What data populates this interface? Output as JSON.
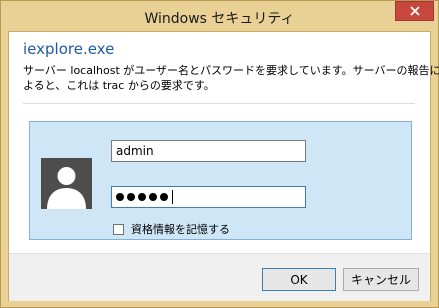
{
  "window": {
    "title": "Windows セキュリティ",
    "close_icon": "close-icon"
  },
  "dialog": {
    "app_name": "iexplore.exe",
    "message_line1": "サーバー localhost がユーザー名とパスワードを要求しています。サーバーの報告に",
    "message_line2": "よると、これは trac からの要求です。"
  },
  "credentials": {
    "avatar_icon": "user-avatar-icon",
    "username_value": "admin",
    "password_masked_length": 5,
    "remember_label": "資格情報を記憶する",
    "remember_checked": false
  },
  "buttons": {
    "ok_label": "OK",
    "cancel_label": "キャンセル"
  },
  "colors": {
    "frame": "#e9d196",
    "close_button": "#c7463d",
    "app_name": "#1e5aa8",
    "panel": "#cfe6f6",
    "panel_border": "#7fb2dc"
  }
}
